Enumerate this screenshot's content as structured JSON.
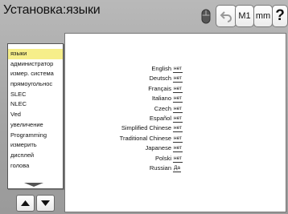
{
  "header": {
    "title": "Установка:языки",
    "mouse_icon": "mouse-icon",
    "undo_icon": "undo-arrow-icon",
    "m1_label": "M1",
    "mm_label": "mm",
    "help_label": "?"
  },
  "sidebar": {
    "items": [
      {
        "label": "языки",
        "selected": true
      },
      {
        "label": "администратор"
      },
      {
        "label": "измер. система"
      },
      {
        "label": "прямоугольнос"
      },
      {
        "label": "SLEC"
      },
      {
        "label": "NLEC"
      },
      {
        "label": "Ved"
      },
      {
        "label": "увеличение"
      },
      {
        "label": "Programming"
      },
      {
        "label": "измерить"
      },
      {
        "label": "дисплей"
      },
      {
        "label": "голова"
      }
    ],
    "scroll_down_icon": "triangle-down-icon",
    "up_icon": "arrow-up-icon",
    "down_icon": "arrow-down-icon"
  },
  "languages": [
    {
      "name": "English",
      "value": "нет"
    },
    {
      "name": "Deutsch",
      "value": "нет"
    },
    {
      "name": "Français",
      "value": "нет"
    },
    {
      "name": "Italiano",
      "value": "нет"
    },
    {
      "name": "Czech",
      "value": "нет"
    },
    {
      "name": "Español",
      "value": "нет"
    },
    {
      "name": "Simplified Chinese",
      "value": "нет"
    },
    {
      "name": "Traditional Chinese",
      "value": "нет"
    },
    {
      "name": "Japanese",
      "value": "нет"
    },
    {
      "name": "Polski",
      "value": "нет"
    },
    {
      "name": "Russian",
      "value": "Да"
    }
  ],
  "colors": {
    "selected_item": "#f6ee8a",
    "background": "#a9a9a9"
  }
}
